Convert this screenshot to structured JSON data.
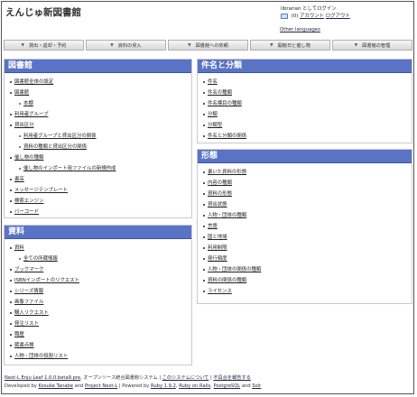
{
  "header": {
    "title": "えんじゅ新図書館",
    "login_status": "librarian としてログイン",
    "mail_count": "(0)",
    "account_link": "アカウント",
    "logout_link": "ログアウト",
    "other_languages": "Other languages"
  },
  "menu": [
    {
      "label": "貸出・返却・予約"
    },
    {
      "label": "資料の受入"
    },
    {
      "label": "図書館への依頼"
    },
    {
      "label": "開館日と催し物"
    },
    {
      "label": "図書館の管理"
    }
  ],
  "panels": {
    "library": {
      "title": "図書館",
      "items": [
        {
          "label": "図書館全体の設定"
        },
        {
          "label": "図書館"
        },
        {
          "label": "本棚",
          "sub": true
        },
        {
          "label": "利用者グループ"
        },
        {
          "label": "貸出区分"
        },
        {
          "label": "利用者グループと貸出区分の関係",
          "sub": true
        },
        {
          "label": "資料の種類と貸出区分の関係",
          "sub": true
        },
        {
          "label": "催し物の種類"
        },
        {
          "label": "催し物のインポート用ファイルの新規作成",
          "sub": true
        },
        {
          "label": "書店"
        },
        {
          "label": "メッセージテンプレート"
        },
        {
          "label": "検索エンジン"
        },
        {
          "label": "バーコード"
        }
      ]
    },
    "subjects": {
      "title": "件名と分類",
      "items": [
        {
          "label": "件名"
        },
        {
          "label": "件名の種類"
        },
        {
          "label": "件名標目の種類"
        },
        {
          "label": "分類"
        },
        {
          "label": "分類型"
        },
        {
          "label": "件名と分類の関係"
        }
      ]
    },
    "materials": {
      "title": "資料",
      "items": [
        {
          "label": "資料"
        },
        {
          "label": "全ての所蔵情報",
          "sub": true
        },
        {
          "label": "ブックマーク"
        },
        {
          "label": "ISBNインポートのリクエスト"
        },
        {
          "label": "シリーズ情報"
        },
        {
          "label": "画像ファイル"
        },
        {
          "label": "購入リクエスト"
        },
        {
          "label": "発注リスト"
        },
        {
          "label": "職歴"
        },
        {
          "label": "蔵書点検"
        },
        {
          "label": "人物・団体の役割リスト"
        }
      ]
    },
    "forms": {
      "title": "形態",
      "items": [
        {
          "label": "書いた資料の形態"
        },
        {
          "label": "内容の種類"
        },
        {
          "label": "資料の形態"
        },
        {
          "label": "貸出状態"
        },
        {
          "label": "人物・団体の種類"
        },
        {
          "label": "言語"
        },
        {
          "label": "国と地域"
        },
        {
          "label": "利用制限"
        },
        {
          "label": "発行頻度"
        },
        {
          "label": "人物・団体の関係の種類"
        },
        {
          "label": "資料の関係の種類"
        },
        {
          "label": "ライセンス"
        }
      ]
    }
  },
  "footer": {
    "line1_link1": "Next-L Enju Leaf 1.0.0.beta9.pre",
    "line1_text1": ", オープンソース統合図書館システム | ",
    "line1_link2": "このシステムについて",
    "line1_sep": " | ",
    "line1_link3": "不具合を報告する",
    "line2_text1": "Developed by ",
    "line2_link1": "Kosuke Tanabe",
    "line2_text2": " and ",
    "line2_link2": "Project Next-L",
    "line2_text3": " | Powered by ",
    "line2_link3": "Ruby 1.9.2",
    "line2_text4": ", ",
    "line2_link4": "Ruby on Rails",
    "line2_text5": ", ",
    "line2_link5": "PostgreSQL",
    "line2_text6": " and ",
    "line2_link6": "Solr"
  }
}
